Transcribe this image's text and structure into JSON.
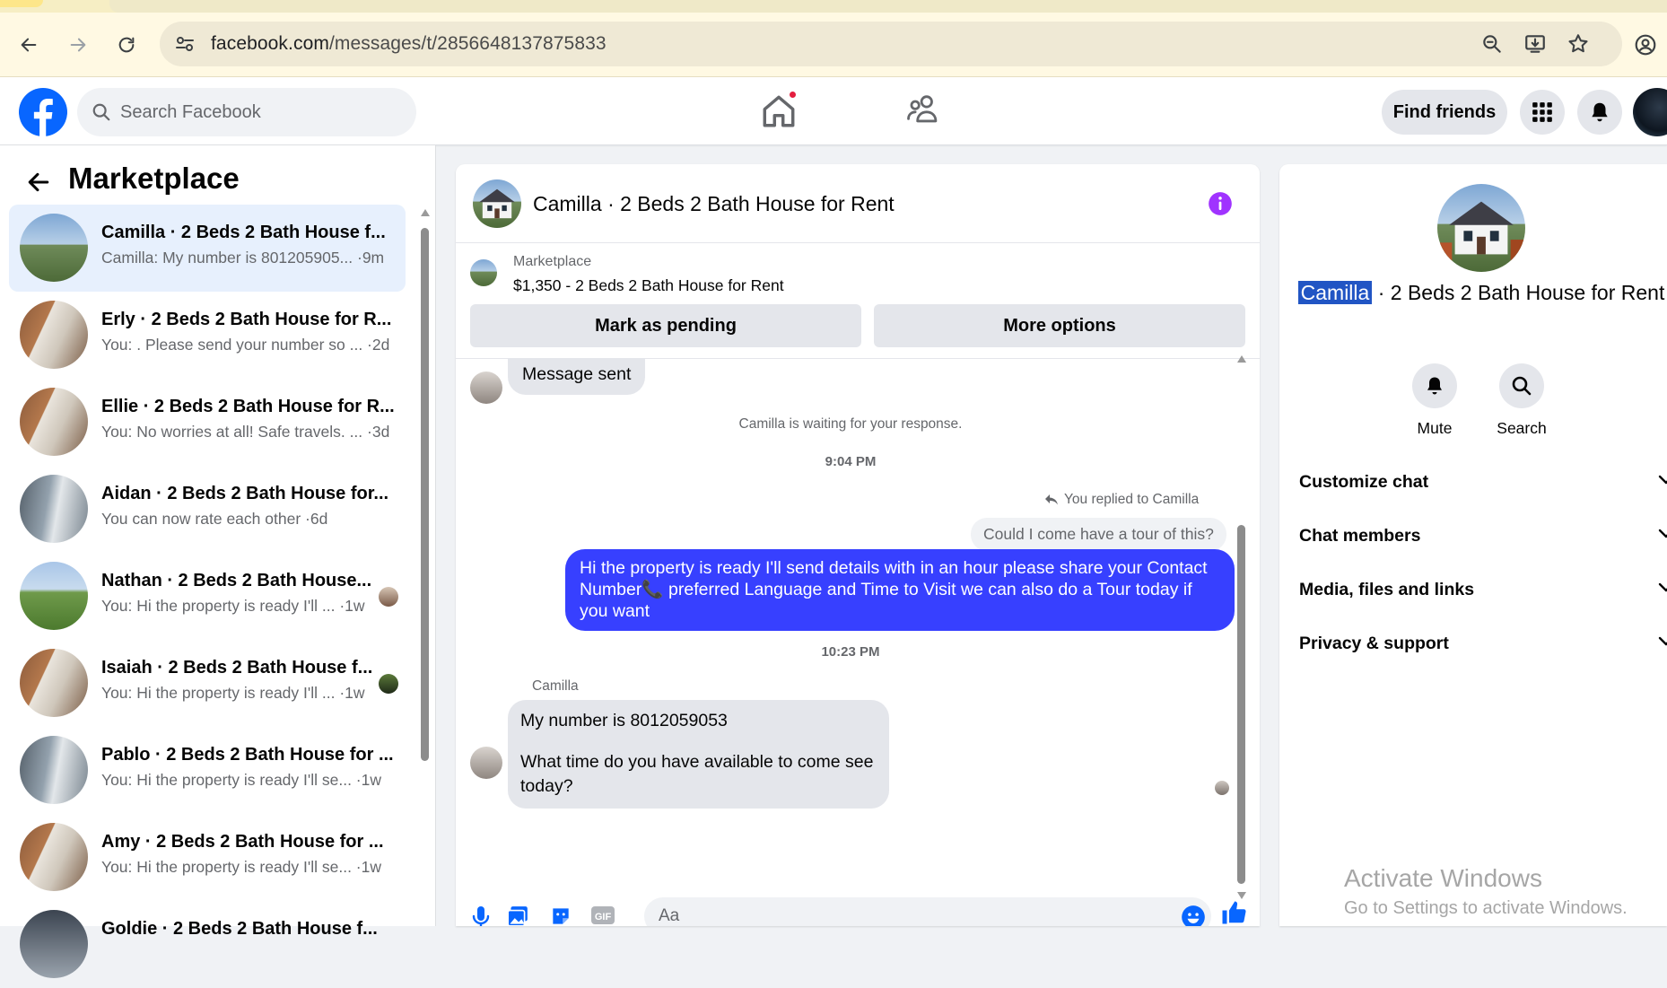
{
  "browser": {
    "url_domain": "facebook.com",
    "url_path": "/messages/t/2856648137875833"
  },
  "header": {
    "search_placeholder": "Search Facebook",
    "find_friends_label": "Find friends"
  },
  "left": {
    "title": "Marketplace",
    "conversations": [
      {
        "name": "Camilla · 2 Beds 2 Bath House f...",
        "preview": "Camilla: My number is 801205905... ·9m",
        "avatar": "house",
        "active": true
      },
      {
        "name": "Erly · 2 Beds 2 Bath House for R...",
        "preview": "You: . Please send your number so ... ·2d",
        "avatar": "room"
      },
      {
        "name": "Ellie · 2 Beds 2 Bath House for R...",
        "preview": "You: No worries at all! Safe travels. ... ·3d",
        "avatar": "room"
      },
      {
        "name": "Aidan · 2 Beds 2 Bath House for...",
        "preview": "You can now rate each other ·6d",
        "avatar": "bath"
      },
      {
        "name": "Nathan · 2 Beds 2 Bath House...",
        "preview": "You: Hi the property is ready I'll ... ·1w",
        "avatar": "yard"
      },
      {
        "name": "Isaiah · 2 Beds 2 Bath House f...",
        "preview": "You: Hi the property is ready I'll ... ·1w",
        "avatar": "room"
      },
      {
        "name": "Pablo · 2 Beds 2 Bath House for ...",
        "preview": "You: Hi the property is ready I'll se... ·1w",
        "avatar": "bath"
      },
      {
        "name": "Amy · 2 Beds 2 Bath House for ...",
        "preview": "You: Hi the property is ready I'll se... ·1w",
        "avatar": "room"
      },
      {
        "name": "Goldie · 2 Beds 2 Bath House f...",
        "preview": "",
        "avatar": "dark"
      }
    ]
  },
  "chat": {
    "title": "Camilla · 2 Beds 2 Bath House for Rent",
    "listing_source": "Marketplace",
    "listing_title": "$1,350 - 2 Beds 2 Bath House for Rent",
    "mark_pending_label": "Mark as pending",
    "more_options_label": "More options",
    "messages": {
      "sent_notice": "Message sent",
      "waiting": "Camilla is waiting for your response.",
      "time1": "9:04 PM",
      "reply_label": "You replied to Camilla",
      "reply_quote": "Could I come have a tour of this?",
      "outgoing": "Hi the property is ready I'll send details with in an hour please share your Contact Number📞 preferred Language and Time to Visit we can also do a Tour today if you want",
      "time2": "10:23 PM",
      "sender": "Camilla",
      "incoming_line1": "My number is 8012059053",
      "incoming_line2": "What time do you have available to come see today?"
    },
    "composer_placeholder": "Aa"
  },
  "right": {
    "name_selected": "Camilla",
    "name_rest": " · 2 Beds 2 Bath House for Rent",
    "mute_label": "Mute",
    "search_label": "Search",
    "sections": [
      "Customize chat",
      "Chat members",
      "Media, files and links",
      "Privacy & support"
    ]
  },
  "watermark": {
    "title": "Activate Windows",
    "subtitle": "Go to Settings to activate Windows."
  },
  "colors": {
    "facebook_blue": "#0866ff",
    "outgoing_bubble": "#3740ff",
    "info_purple": "#a033ff",
    "notification_red": "#e41e3f"
  }
}
